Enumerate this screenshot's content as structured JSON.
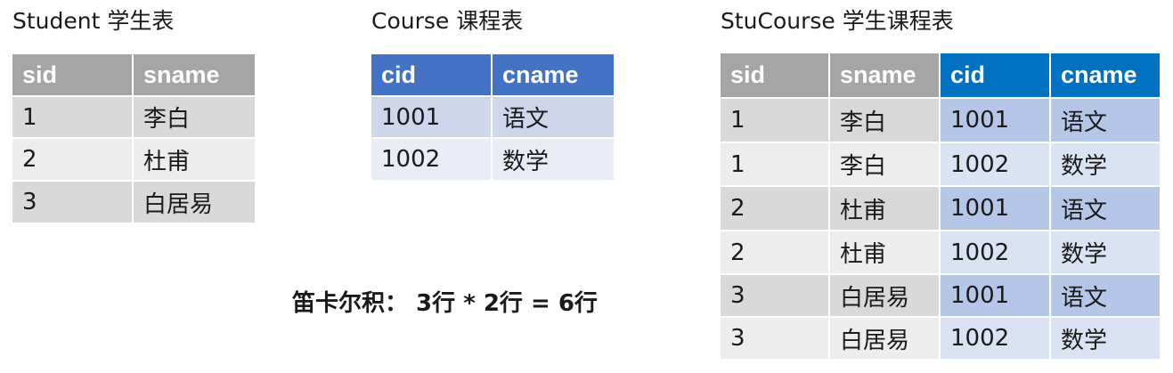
{
  "student": {
    "title": "Student 学生表",
    "headers": [
      "sid",
      "sname"
    ],
    "rows": [
      [
        "1",
        "李白"
      ],
      [
        "2",
        "杜甫"
      ],
      [
        "3",
        "白居易"
      ]
    ]
  },
  "course": {
    "title": "Course 课程表",
    "headers": [
      "cid",
      "cname"
    ],
    "rows": [
      [
        "1001",
        "语文"
      ],
      [
        "1002",
        "数学"
      ]
    ]
  },
  "stucourse": {
    "title": "StuCourse 学生课程表",
    "headers": [
      "sid",
      "sname",
      "cid",
      "cname"
    ],
    "rows": [
      [
        "1",
        "李白",
        "1001",
        "语文"
      ],
      [
        "1",
        "李白",
        "1002",
        "数学"
      ],
      [
        "2",
        "杜甫",
        "1001",
        "语文"
      ],
      [
        "2",
        "杜甫",
        "1002",
        "数学"
      ],
      [
        "3",
        "白居易",
        "1001",
        "语文"
      ],
      [
        "3",
        "白居易",
        "1002",
        "数学"
      ]
    ]
  },
  "caption": "笛卡尔积： 3行 * 2行 = 6行",
  "colors": {
    "gray_header": "#a5a5a5",
    "gray_row_dark": "#d9d9d9",
    "gray_row_light": "#ededed",
    "blue_header_course": "#4472c4",
    "blue_row_dark_course": "#cfd5ea",
    "blue_row_light_course": "#e9ebf5",
    "blue_header_stucourse": "#0070c0",
    "blue_row_dark_stucourse": "#b4c7e7",
    "blue_row_light_stucourse": "#dae3f3"
  }
}
